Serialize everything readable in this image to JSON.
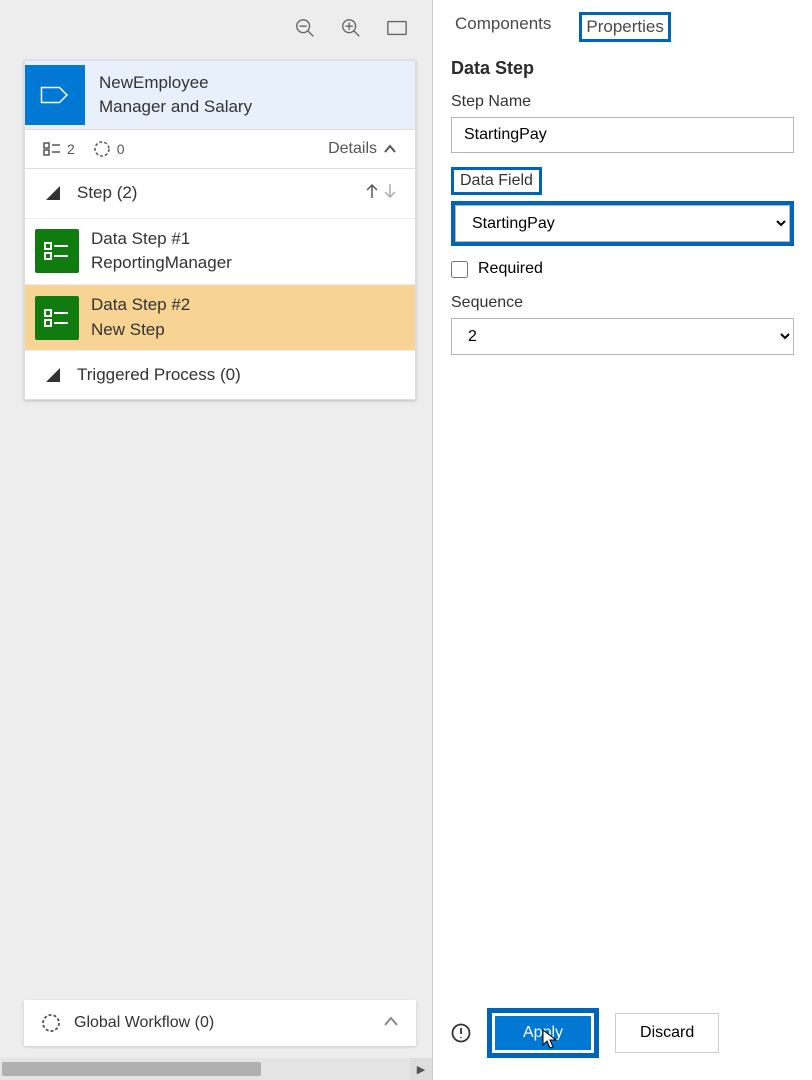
{
  "toolbar": {
    "zoom_out": "zoom-out-icon",
    "zoom_in": "zoom-in-icon",
    "fit": "fit-screen-icon"
  },
  "workflow": {
    "header_title": "NewEmployee",
    "header_sub": "Manager and Salary",
    "list_count": "2",
    "cycle_count": "0",
    "details_label": "Details",
    "step_label": "Step (2)",
    "data_steps": [
      {
        "title": "Data Step #1",
        "sub": "ReportingManager"
      },
      {
        "title": "Data Step #2",
        "sub": "New Step"
      }
    ],
    "triggered_label": "Triggered Process (0)",
    "global_label": "Global Workflow (0)"
  },
  "tabs": {
    "components": "Components",
    "properties": "Properties"
  },
  "properties": {
    "panel_title": "Data Step",
    "step_name_label": "Step Name",
    "step_name_value": "StartingPay",
    "data_field_label": "Data Field",
    "data_field_value": "StartingPay",
    "required_label": "Required",
    "sequence_label": "Sequence",
    "sequence_value": "2"
  },
  "footer": {
    "apply": "Apply",
    "discard": "Discard"
  }
}
